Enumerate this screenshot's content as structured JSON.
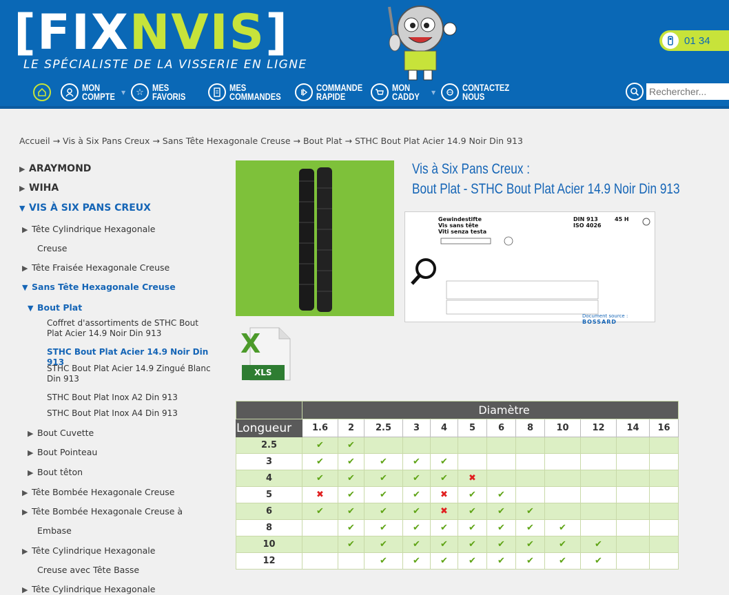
{
  "header": {
    "brand_open": "[",
    "brand_fix": "FIX",
    "brand_nvis": "NVIS",
    "brand_close": "]",
    "tagline": "LE SPÉCIALISTE DE LA VISSERIE EN LIGNE",
    "phone": "01 34",
    "search_placeholder": "Rechercher..."
  },
  "nav": {
    "items": [
      {
        "label": "MON COMPTE",
        "icon": "user-icon"
      },
      {
        "label": "MES FAVORIS",
        "icon": "star-icon"
      },
      {
        "label": "MES COMMANDES",
        "icon": "document-icon"
      },
      {
        "label": "COMMANDE RAPIDE",
        "icon": "fast-forward-icon"
      },
      {
        "label": "MON CADDY",
        "icon": "cart-icon"
      },
      {
        "label": "CONTACTEZ NOUS",
        "icon": "chat-icon"
      }
    ]
  },
  "breadcrumb": "Accueil → Vis à Six Pans Creux → Sans Tête Hexagonale Creuse → Bout Plat → STHC Bout Plat Acier 14.9 Noir Din 913",
  "sidebar": {
    "araymond": "ARAYMOND",
    "wiha": "WIHA",
    "vis": "VIS À SIX PANS CREUX",
    "tete_cyl_1": "Tête Cylindrique Hexagonale",
    "tete_cyl_1b": "Creuse",
    "tete_frai": "Tête Fraisée Hexagonale Creuse",
    "sans_tete": "Sans Tête Hexagonale Creuse",
    "bout_plat": "Bout Plat",
    "leaf_1a": "Coffret d'assortiments de STHC Bout",
    "leaf_1b": "Plat Acier 14.9 Noir Din 913",
    "leaf_2": "STHC Bout Plat Acier 14.9 Noir Din 913",
    "leaf_3a": "STHC Bout Plat Acier 14.9 Zingué Blanc",
    "leaf_3b": "Din 913",
    "leaf_4": "STHC Bout Plat Inox A2 Din 913",
    "leaf_5": "STHC Bout Plat Inox A4 Din 913",
    "bout_cuvette": "Bout Cuvette",
    "bout_pointeau": "Bout Pointeau",
    "bout_teton": "Bout têton",
    "tete_bombee": "Tête Bombée Hexagonale Creuse",
    "tete_bombee_emb_a": "Tête Bombée Hexagonale Creuse à",
    "tete_bombee_emb_b": "Embase",
    "tete_cyl_basse_a": "Tête Cylindrique Hexagonale",
    "tete_cyl_basse_b": "Creuse avec Tête Basse",
    "tete_cyl_last": "Tête Cylindrique Hexagonale"
  },
  "product": {
    "title_line1": "Vis à Six Pans Creux :",
    "title_line2": "Bout Plat - STHC Bout Plat Acier 14.9 Noir Din 913",
    "xls_label": "XLS",
    "doc_title_1": "Gewindestifte",
    "doc_title_2": "Vis sans tête",
    "doc_title_3": "Viti senza testa",
    "doc_din": "DIN 913",
    "doc_iso": "ISO 4026",
    "doc_grade": "45 H",
    "doc_source_label": "Document source :",
    "doc_source": "BOSSARD"
  },
  "table": {
    "group_header": "Diamètre",
    "row_header": "Longueur",
    "diameters": [
      "1.6",
      "2",
      "2.5",
      "3",
      "4",
      "5",
      "6",
      "8",
      "10",
      "12",
      "14",
      "16"
    ],
    "rows": [
      {
        "len": "2.5",
        "cells": [
          "ok",
          "ok",
          "",
          "",
          "",
          "",
          "",
          "",
          "",
          "",
          "",
          ""
        ]
      },
      {
        "len": "3",
        "cells": [
          "ok",
          "ok",
          "ok",
          "ok",
          "ok",
          "",
          "",
          "",
          "",
          "",
          "",
          ""
        ]
      },
      {
        "len": "4",
        "cells": [
          "ok",
          "ok",
          "ok",
          "ok",
          "ok",
          "no",
          "",
          "",
          "",
          "",
          "",
          ""
        ]
      },
      {
        "len": "5",
        "cells": [
          "no",
          "ok",
          "ok",
          "ok",
          "no",
          "ok",
          "ok",
          "",
          "",
          "",
          "",
          ""
        ]
      },
      {
        "len": "6",
        "cells": [
          "ok",
          "ok",
          "ok",
          "ok",
          "no",
          "ok",
          "ok",
          "ok",
          "",
          "",
          "",
          ""
        ]
      },
      {
        "len": "8",
        "cells": [
          "",
          "ok",
          "ok",
          "ok",
          "ok",
          "ok",
          "ok",
          "ok",
          "ok",
          "",
          "",
          ""
        ]
      },
      {
        "len": "10",
        "cells": [
          "",
          "ok",
          "ok",
          "ok",
          "ok",
          "ok",
          "ok",
          "ok",
          "ok",
          "ok",
          "",
          ""
        ]
      },
      {
        "len": "12",
        "cells": [
          "",
          "",
          "ok",
          "ok",
          "ok",
          "ok",
          "ok",
          "ok",
          "ok",
          "ok",
          "",
          ""
        ]
      }
    ]
  }
}
